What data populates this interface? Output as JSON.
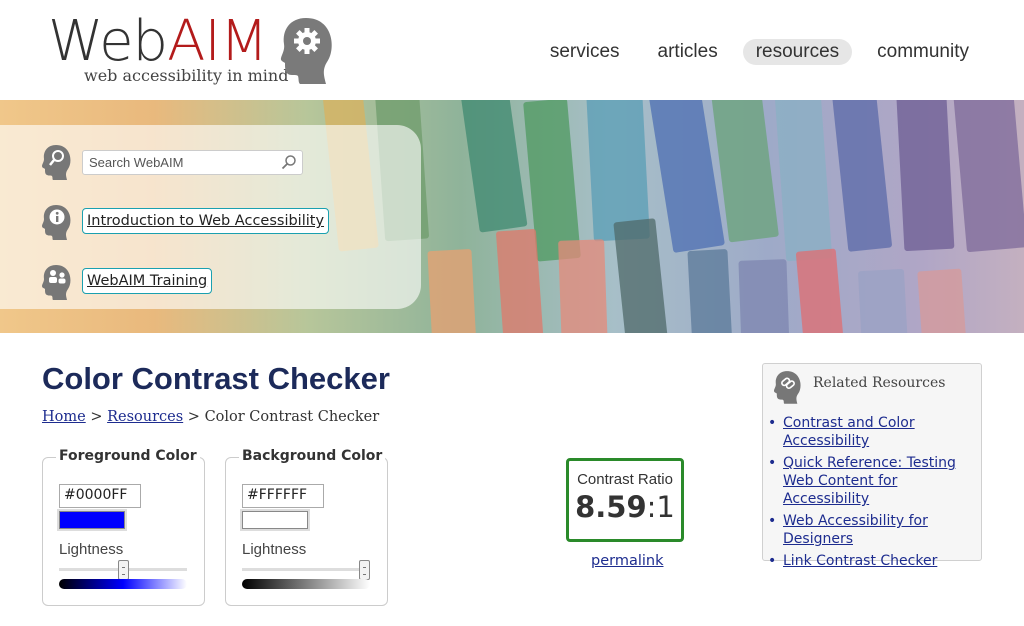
{
  "header": {
    "logo_word_web": "Web",
    "logo_word_aim": "AIM",
    "logo_tagline": "web accessibility in mind",
    "nav": [
      {
        "label": "services"
      },
      {
        "label": "articles"
      },
      {
        "label": "resources",
        "active": true
      },
      {
        "label": "community"
      }
    ]
  },
  "banner": {
    "search_placeholder": "Search WebAIM",
    "links": [
      {
        "label": "Introduction to Web Accessibility"
      },
      {
        "label": "WebAIM Training"
      }
    ]
  },
  "main": {
    "title": "Color Contrast Checker",
    "breadcrumb": {
      "home": "Home",
      "sep1": ">",
      "resources": "Resources",
      "sep2": ">",
      "current": "Color Contrast Checker"
    },
    "foreground": {
      "legend": "Foreground Color",
      "hex": "#0000FF",
      "swatch_color": "#0000FF",
      "lightness_label": "Lightness",
      "lightness": 0.5
    },
    "background": {
      "legend": "Background Color",
      "hex": "#FFFFFF",
      "swatch_color": "#FFFFFF",
      "lightness_label": "Lightness",
      "lightness": 1.0
    },
    "contrast": {
      "label": "Contrast Ratio",
      "ratio": "8.59",
      "suffix": ":1",
      "pass_color": "#2a8a2a"
    },
    "permalink": "permalink"
  },
  "related": {
    "title": "Related Resources",
    "items": [
      {
        "label": "Contrast and Color Accessibility"
      },
      {
        "label": "Quick Reference: Testing Web Content for Accessibility"
      },
      {
        "label": "Web Accessibility for Designers"
      },
      {
        "label": "Link Contrast Checker"
      }
    ]
  },
  "colors": {
    "title": "#1c2a5a",
    "link": "#1d2c8f",
    "logo_accent": "#b31b1b"
  }
}
